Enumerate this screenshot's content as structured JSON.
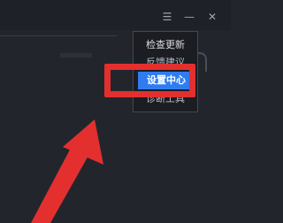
{
  "window_controls": {
    "menu_icon": "hamburger-icon",
    "minimize_icon": "minus-icon",
    "close_icon": "close-icon"
  },
  "dropdown_menu": {
    "items": [
      {
        "label": "检查更新"
      },
      {
        "label": "反馈建议"
      },
      {
        "label": "设置中心"
      },
      {
        "label": "诊断工具"
      }
    ],
    "selected_index": 2
  },
  "annotation": {
    "box_color": "#e3302f",
    "arrow_color": "#e3302f"
  },
  "colors": {
    "background": "#23252d",
    "menu_background": "#1b1d23",
    "selected_background": "#2f7cf1"
  }
}
